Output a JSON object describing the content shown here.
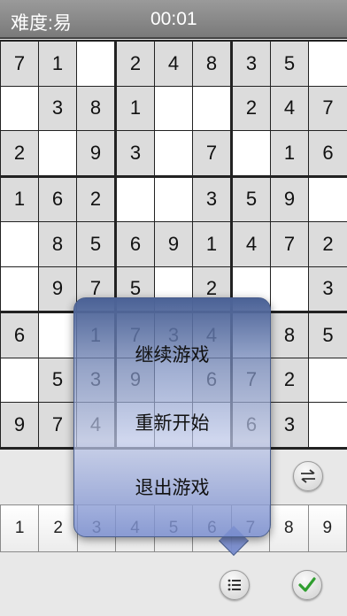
{
  "header": {
    "difficulty": "难度:易",
    "timer": "00:01"
  },
  "board": [
    [
      "7",
      "1",
      "",
      "2",
      "4",
      "8",
      "3",
      "5",
      ""
    ],
    [
      "",
      "3",
      "8",
      "1",
      "",
      "",
      "2",
      "4",
      "7"
    ],
    [
      "2",
      "",
      "9",
      "3",
      "",
      "7",
      "",
      "1",
      "6"
    ],
    [
      "1",
      "6",
      "2",
      "",
      "",
      "3",
      "5",
      "9",
      ""
    ],
    [
      "",
      "8",
      "5",
      "6",
      "9",
      "1",
      "4",
      "7",
      "2"
    ],
    [
      "",
      "9",
      "7",
      "5",
      "",
      "2",
      "",
      "",
      "3"
    ],
    [
      "6",
      "",
      "1",
      "7",
      "3",
      "4",
      "",
      "8",
      "5"
    ],
    [
      "",
      "5",
      "3",
      "9",
      "",
      "6",
      "7",
      "2",
      ""
    ],
    [
      "9",
      "7",
      "4",
      "",
      "",
      "",
      "6",
      "3",
      ""
    ]
  ],
  "numpad": [
    "1",
    "2",
    "3",
    "4",
    "5",
    "6",
    "7",
    "8",
    "9"
  ],
  "menu": {
    "resume": "继续游戏",
    "restart": "重新开始",
    "quit": "退出游戏"
  },
  "icons": {
    "swap": "swap-arrows-icon",
    "list": "list-icon",
    "check": "checkmark-icon"
  },
  "colors": {
    "check_green": "#2f9e2f",
    "popup_blue": "#4b6296"
  }
}
